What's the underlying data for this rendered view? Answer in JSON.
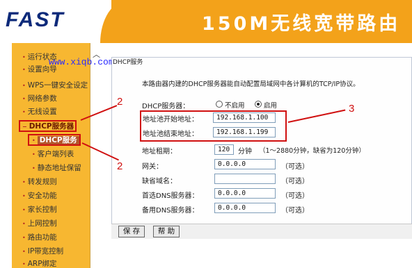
{
  "header": {
    "logo": "FAST",
    "title": "150M无线宽带路由"
  },
  "watermark": "www.xiqb.com",
  "sidebar": {
    "items": [
      {
        "label": "运行状态"
      },
      {
        "label": "设置向导"
      },
      {
        "label": "WPS一键安全设定"
      },
      {
        "label": "网络参数"
      },
      {
        "label": "无线设置"
      },
      {
        "label": "DHCP服务器"
      },
      {
        "label": "DHCP服务"
      },
      {
        "label": "客户端列表"
      },
      {
        "label": "静态地址保留"
      },
      {
        "label": "转发规则"
      },
      {
        "label": "安全功能"
      },
      {
        "label": "家长控制"
      },
      {
        "label": "上网控制"
      },
      {
        "label": "路由功能"
      },
      {
        "label": "IP带宽控制"
      },
      {
        "label": "ARP绑定"
      }
    ]
  },
  "main": {
    "section_title": "DHCP服务",
    "description": "本路由器内建的DHCP服务器能自动配置局域网中各计算机的TCP/IP协议。",
    "dhcp_server_label": "DHCP服务器：",
    "option_disable": "不启用",
    "option_enable": "启用",
    "selected": "启用",
    "pool_start_label": "地址池开始地址：",
    "pool_start_value": "192.168.1.100",
    "pool_end_label": "地址池结束地址：",
    "pool_end_value": "192.168.1.199",
    "lease_label": "地址租期：",
    "lease_value": "120",
    "lease_unit": "分钟",
    "lease_hint": "（1～2880分钟，缺省为120分钟）",
    "gateway_label": "网关：",
    "gateway_value": "0.0.0.0",
    "optional": "（可选）",
    "domain_label": "缺省域名：",
    "domain_value": "",
    "dns1_label": "首选DNS服务器：",
    "dns1_value": "0.0.0.0",
    "dns2_label": "备用DNS服务器：",
    "dns2_value": "0.0.0.0",
    "save_button": "保 存",
    "help_button": "帮 助"
  },
  "annotations": {
    "label_2a": "2",
    "label_2b": "2",
    "label_3": "3",
    "color": "#d01010"
  }
}
